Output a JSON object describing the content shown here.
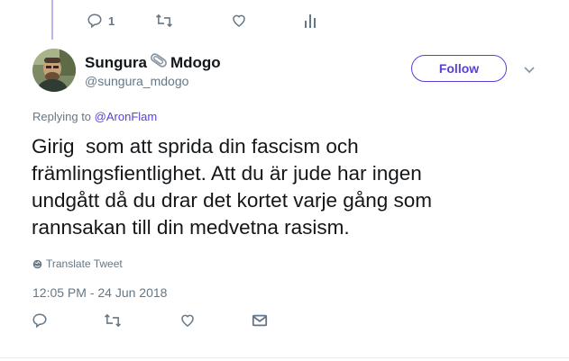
{
  "previous_tweet": {
    "reply_count": "1"
  },
  "author": {
    "name_first": "Sungura",
    "name_second": "Mdogo",
    "handle": "@sungura_mdogo"
  },
  "follow_label": "Follow",
  "replying": {
    "prefix": "Replying to ",
    "mention": "@AronFlam"
  },
  "tweet": {
    "text": "Girig  som att sprida din fascism och\nfrämlingsfientlighet. Att du är jude har ingen\nundgått då du drar det kortet varje gång som\nrannsakan till din medvetna rasism."
  },
  "translate_label": "Translate Tweet",
  "timestamp": "12:05 PM - 24 Jun 2018",
  "colors": {
    "accent": "#5b3fd4",
    "muted": "#657786",
    "thread_line": "#c2b3f0"
  },
  "icons": [
    "reply-icon",
    "retweet-icon",
    "like-icon",
    "analytics-icon",
    "paperclip-icon",
    "chevron-down-icon",
    "globe-icon",
    "direct-message-icon"
  ]
}
